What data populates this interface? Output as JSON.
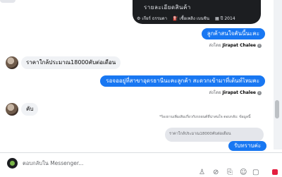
{
  "post": {
    "title": "รายละเอียดสินค้า",
    "meta": [
      {
        "icon": "gear-icon",
        "text": "เกียร์ ธรรมดา"
      },
      {
        "icon": "fuel-icon",
        "text": "เชื้อเพลิง เบนซิน"
      },
      {
        "icon": "calendar-icon",
        "text": "ปี 2014"
      }
    ]
  },
  "messages": {
    "out1": "ลูกค้าสนใจคันนี้นะคะ",
    "sent_prefix": "ส่งโดย",
    "sender": "Jirapat Chalee",
    "in1": "ราคาใกล้ประมาณ18000คับต่อเดือน",
    "out2": "รอจออยู่ที่สาขาอุดรธานีนะคะลูกค้า สะดวกเข้ามาที่เต้นท์ไหมคะ",
    "in2": "คับ",
    "reply_context": "*ร้องถามเพิ่มเติมเกี่ยวกับรถยนต์ที่น่าสนใจ ตอบกลับ: ข้อมูลนี้",
    "quoted": "ราคาใกล้ประมาณ18000คับต่อเดือน",
    "out3": "รับทราบค่ะ"
  },
  "composer": {
    "placeholder": "ตอบกลับใน Messenger..."
  },
  "toolbar": [
    "add-person-icon",
    "link-icon",
    "attachment-icon",
    "emoji-icon",
    "sticker-icon",
    "like-icon"
  ],
  "colors": {
    "accent": "#1877f2",
    "incoming": "#f0f2f5",
    "dark_card": "#1c1e21"
  }
}
